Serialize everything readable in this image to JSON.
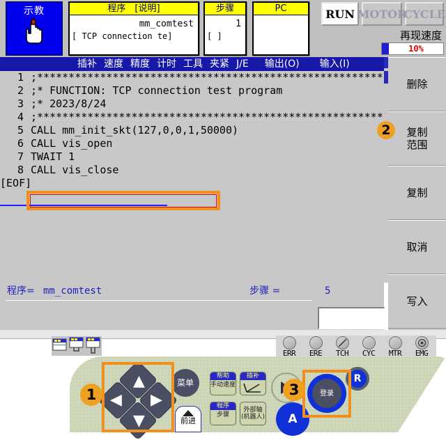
{
  "status_bar": {
    "mode_button": {
      "label": "示教",
      "icon": "hand-pointer-icon"
    },
    "program_field": {
      "header": "程序　[说明]",
      "value": "mm_comtest",
      "sub": "[ TCP connection te]"
    },
    "step_field": {
      "header": "步骤",
      "value": "1",
      "sub": "[          ]"
    },
    "pc_field": {
      "header": "PC",
      "value": "",
      "sub": ""
    },
    "run_button": "RUN",
    "motor_button": "MOTOR",
    "cycle_button": "CYCLE",
    "speed_label": "再现速度",
    "speed_value": "10%"
  },
  "menu_bar": {
    "items": [
      "插补",
      "速度",
      "精度",
      "计时",
      "工具",
      "夹紧",
      "J/E",
      "输出(O)",
      "输入(I)"
    ]
  },
  "code": {
    "lines": [
      {
        "num": "1",
        "text": ";***************************************************************"
      },
      {
        "num": "2",
        "text": ";* FUNCTION: TCP connection test program"
      },
      {
        "num": "3",
        "text": ";* 2023/8/24"
      },
      {
        "num": "4",
        "text": ";***************************************************************"
      },
      {
        "num": "5",
        "text": "CALL mm_init_skt(127,0,0,1,50000)"
      },
      {
        "num": "6",
        "text": "CALL vis_open"
      },
      {
        "num": "7",
        "text": "TWAIT 1"
      },
      {
        "num": "8",
        "text": "CALL vis_close"
      }
    ],
    "eof": "[EOF]",
    "selected_line": "5"
  },
  "footer": {
    "program_label": "程序=",
    "program_value": "mm_comtest",
    "step_label": "步骤 =",
    "step_value": "5",
    "input_value": ""
  },
  "side_buttons": [
    {
      "label": "删除"
    },
    {
      "label": "复制\n范围"
    },
    {
      "label": "复制"
    },
    {
      "label": "取消"
    },
    {
      "label": "写入"
    }
  ],
  "indicators": [
    {
      "name": "ERR"
    },
    {
      "name": "ERE"
    },
    {
      "name": "TCH"
    },
    {
      "name": "CYC"
    },
    {
      "name": "MTR"
    },
    {
      "name": "EMG"
    }
  ],
  "pendant": {
    "dpad": {
      "up": "▲",
      "down": "▼",
      "left": "◀",
      "right": "▶"
    },
    "menu_button": "菜单",
    "forward_button": "前进",
    "keys": [
      {
        "header": "帮助",
        "body": "手动速度"
      },
      {
        "header": "插补",
        "body": ""
      },
      {
        "header": "程序",
        "body": "步骤"
      },
      {
        "header": "",
        "body": "外部轴\n(机器人)"
      }
    ],
    "register_button": "登录",
    "a_button": "A",
    "r_button": "R"
  },
  "callouts": [
    {
      "number": "1"
    },
    {
      "number": "2"
    },
    {
      "number": "3"
    }
  ],
  "colors": {
    "accent_orange": "#f0a020",
    "menu_blue": "#1818a8",
    "header_yellow": "#ffff00",
    "speed_red": "#e00000"
  }
}
